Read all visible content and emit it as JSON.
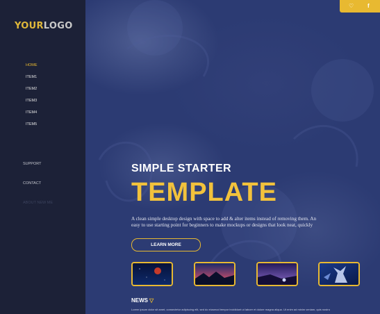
{
  "logo": {
    "part1": "YOUR",
    "part2": "LOGO"
  },
  "nav": {
    "items": [
      {
        "label": "HOME",
        "active": true
      },
      {
        "label": "ITEM1"
      },
      {
        "label": "ITEM2"
      },
      {
        "label": "ITEM3"
      },
      {
        "label": "ITEM4"
      },
      {
        "label": "ITEM5"
      }
    ]
  },
  "secondary_nav": {
    "items": [
      {
        "label": "SUPPORT"
      },
      {
        "label": "CONTACT"
      },
      {
        "label": "ABOUT NEW ME"
      }
    ]
  },
  "topbar": {
    "icons": [
      "heart-icon",
      "facebook-icon"
    ],
    "heart_glyph": "♡",
    "facebook_glyph": "f"
  },
  "hero": {
    "headline": "SIMPLE STARTER",
    "title": "TEMPLATE",
    "description": "A clean simple desktop design with space to add & alter items instead of removing them. An easy to use starting point for beginners to make mockups or designs that look neat, quickly",
    "button_label": "LEARN MORE"
  },
  "thumbnails": [
    {
      "name": "red-planet-thumbnail",
      "colors": [
        "#0a1a4a",
        "#c43a2a"
      ]
    },
    {
      "name": "sunset-mountains-thumbnail",
      "colors": [
        "#1b2a6a",
        "#b44a6a"
      ]
    },
    {
      "name": "purple-dusk-thumbnail",
      "colors": [
        "#241a5a",
        "#8a6ac8"
      ]
    },
    {
      "name": "fantasy-creature-thumbnail",
      "colors": [
        "#1a3a8a",
        "#d4e0ff"
      ]
    }
  ],
  "news": {
    "label": "NEWS",
    "chevron": "▽",
    "text": "Lorem ipsum dolor sit amet, consectetur adipiscing elit, sed do eiusmod tempor incididunt ut labore et dolore magna aliqua. Ut enim ad minim veniam, quis nostrud exercitation."
  },
  "colors": {
    "accent": "#e8b931",
    "sidebar": "#1c2137",
    "main": "#2c3b73"
  }
}
